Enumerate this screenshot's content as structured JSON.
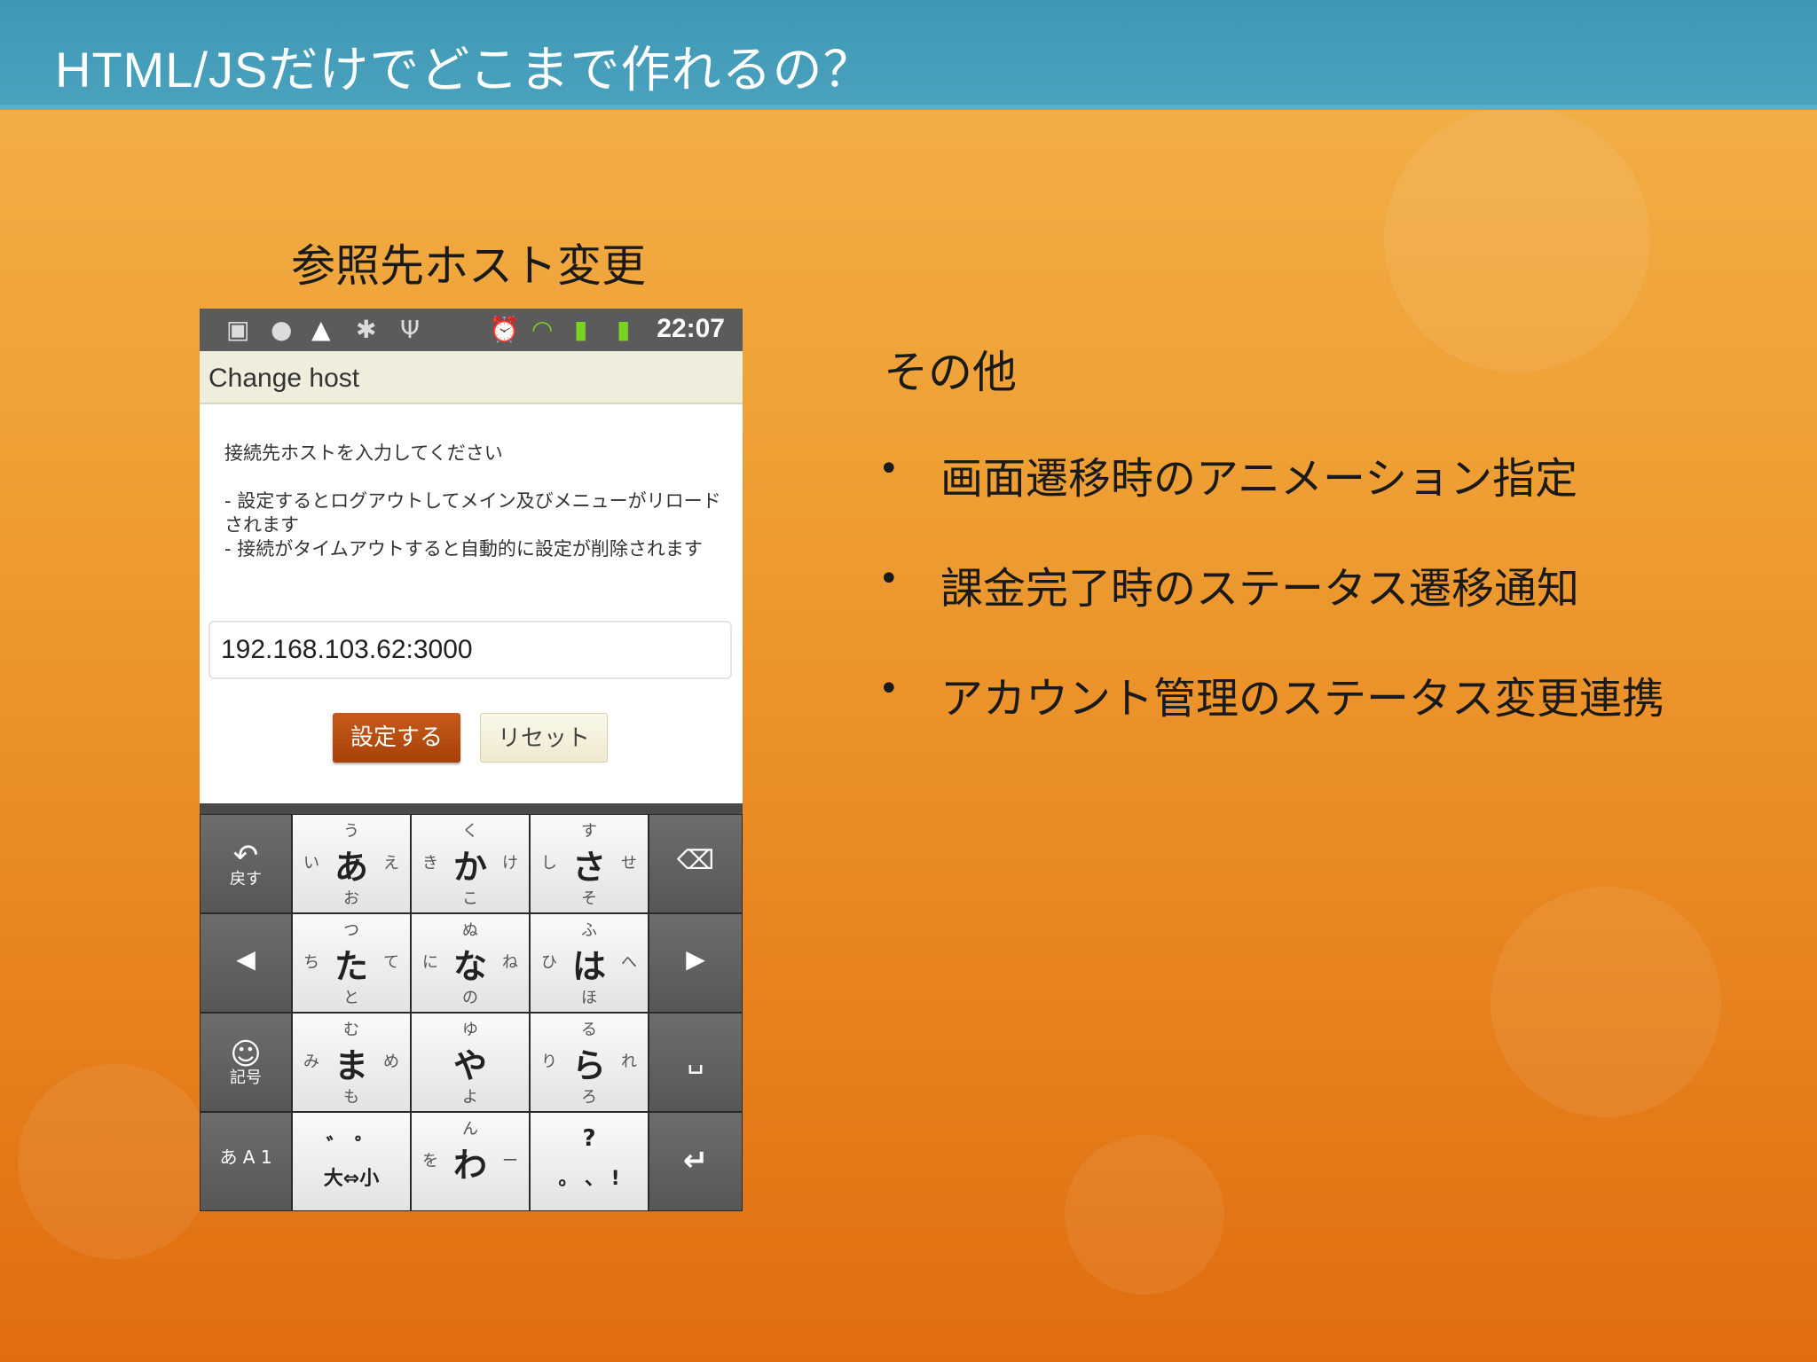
{
  "slide": {
    "title": "HTML/JSだけでどこまで作れるの？",
    "caption": "参照先ホスト変更",
    "other_heading": "その他",
    "bullets": [
      "画面遷移時のアニメーション指定",
      "課金完了時のステータス遷移通知",
      "アカウント管理のステータス変更連携"
    ],
    "colors": {
      "header": "#4aa2bd",
      "accent_button": "#b84b10"
    }
  },
  "phone": {
    "status_time": "22:07",
    "status_icons": [
      "sim-icon",
      "info-icon",
      "warning-icon",
      "android-icon",
      "usb-icon",
      "alarm-icon",
      "wifi-icon",
      "signal-icon",
      "battery-icon"
    ],
    "dialog": {
      "title": "Change host",
      "message_1": "接続先ホストを入力してください",
      "message_2": "- 設定するとログアウトしてメイン及びメニューがリロードされます",
      "message_3": "- 接続がタイムアウトすると自動的に設定が削除されます",
      "host_value": "192.168.103.62:3000",
      "set_label": "設定する",
      "reset_label": "リセット"
    },
    "keyboard": {
      "back": {
        "sym": "↶",
        "label": "戻す"
      },
      "emoji": {
        "sym": "☺",
        "label": "記号"
      },
      "mode_label": "あ A 1",
      "keys": {
        "a": {
          "main": "あ",
          "top": "う",
          "left": "い",
          "right": "え",
          "bottom": "お"
        },
        "ka": {
          "main": "か",
          "top": "く",
          "left": "き",
          "right": "け",
          "bottom": "こ"
        },
        "sa": {
          "main": "さ",
          "top": "す",
          "left": "し",
          "right": "せ",
          "bottom": "そ"
        },
        "ta": {
          "main": "た",
          "top": "つ",
          "left": "ち",
          "right": "て",
          "bottom": "と"
        },
        "na": {
          "main": "な",
          "top": "ぬ",
          "left": "に",
          "right": "ね",
          "bottom": "の"
        },
        "ha": {
          "main": "は",
          "top": "ふ",
          "left": "ひ",
          "right": "へ",
          "bottom": "ほ"
        },
        "ma": {
          "main": "ま",
          "top": "む",
          "left": "み",
          "right": "め",
          "bottom": "も"
        },
        "ya": {
          "main": "や",
          "top": "ゆ",
          "left": "",
          "right": "",
          "bottom": "よ"
        },
        "ra": {
          "main": "ら",
          "top": "る",
          "left": "り",
          "right": "れ",
          "bottom": "ろ"
        },
        "wa": {
          "main": "わ",
          "top": "ん",
          "left": "を",
          "right": "ー",
          "bottom": ""
        }
      },
      "dakuten": {
        "top": "゛ ゜",
        "bottom": "大⇔小"
      },
      "punct": {
        "top": "?",
        "bottom": "。 、 !"
      }
    }
  }
}
